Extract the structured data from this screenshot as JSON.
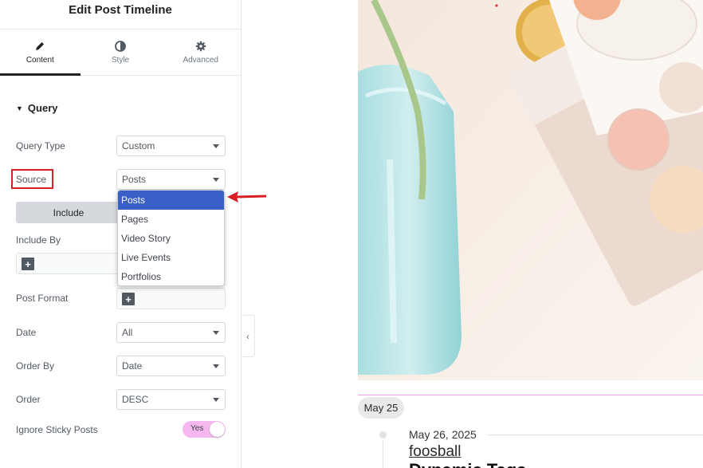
{
  "panel": {
    "title": "Edit Post Timeline",
    "tabs": [
      {
        "label": "Content",
        "icon": "pencil-icon",
        "active": true
      },
      {
        "label": "Style",
        "icon": "half-circle-icon",
        "active": false
      },
      {
        "label": "Advanced",
        "icon": "gear-icon",
        "active": false
      }
    ],
    "section_title": "Query",
    "fields": {
      "query_type": {
        "label": "Query Type",
        "value": "Custom"
      },
      "source": {
        "label": "Source",
        "value": "Posts"
      },
      "include_tab": "Include",
      "include_by": {
        "label": "Include By"
      },
      "post_format": {
        "label": "Post Format"
      },
      "date": {
        "label": "Date",
        "value": "All"
      },
      "order_by": {
        "label": "Order By",
        "value": "Date"
      },
      "order": {
        "label": "Order",
        "value": "DESC"
      },
      "ignore_sticky": {
        "label": "Ignore Sticky Posts",
        "value": "Yes"
      }
    },
    "source_options": [
      "Posts",
      "Pages",
      "Video Story",
      "Live Events",
      "Portfolios"
    ],
    "source_selected": "Posts"
  },
  "preview": {
    "date_badge": "May 25",
    "post_date": "May 26, 2025",
    "post_title": "foosball",
    "post_subtitle": "Dynamic Tags"
  },
  "colors": {
    "highlight": "#d91f26",
    "dropdown_selected": "#3a5fc7",
    "toggle_on": "#f4b8ee",
    "timeline_accent": "#f5a3e8"
  }
}
